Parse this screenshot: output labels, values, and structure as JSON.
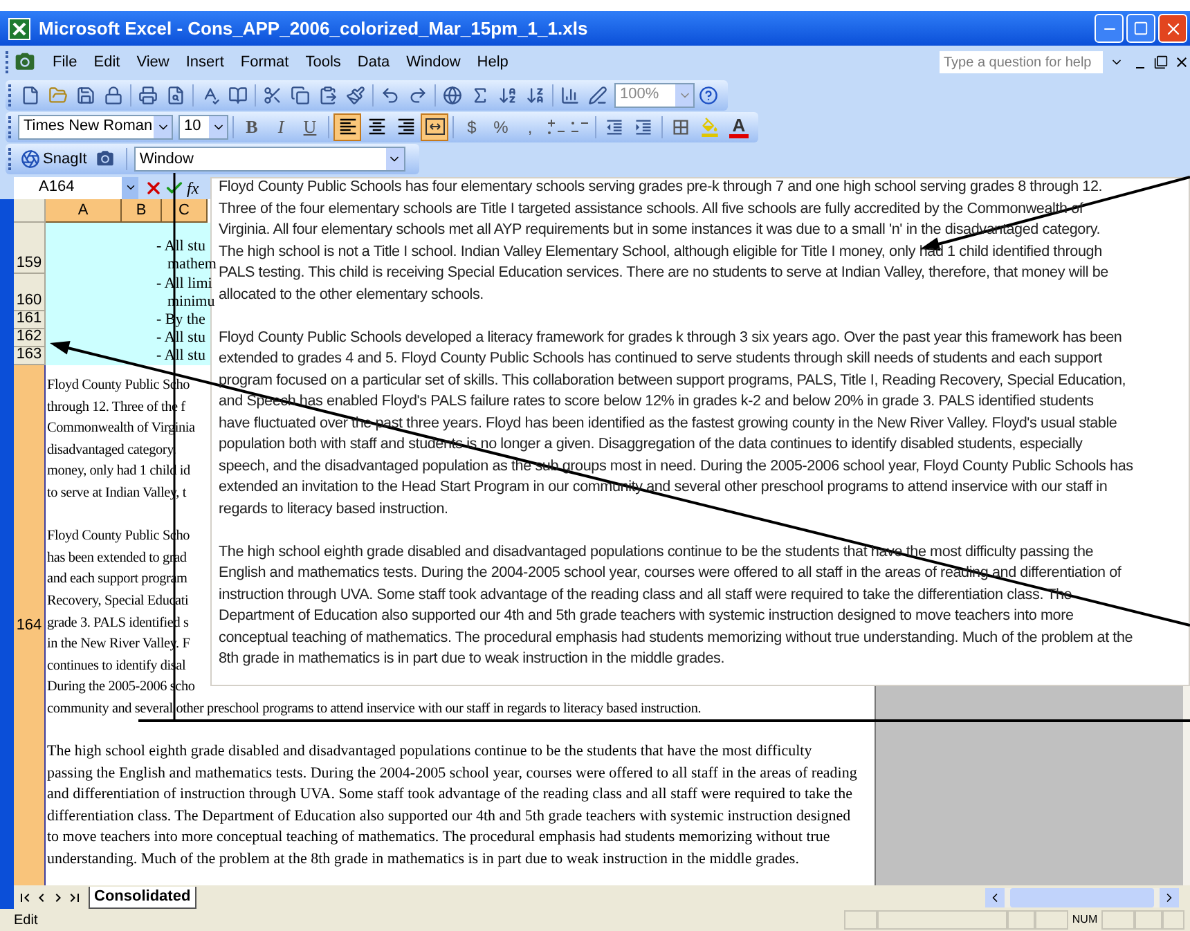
{
  "window": {
    "title": "Microsoft Excel - Cons_APP_2006_colorized_Mar_15pm_1_1.xls"
  },
  "menu": [
    "File",
    "Edit",
    "View",
    "Insert",
    "Format",
    "Tools",
    "Data",
    "Window",
    "Help"
  ],
  "help_box": {
    "placeholder": "Type a question for help"
  },
  "standard_toolbar": {
    "zoom": "100%"
  },
  "formatting_toolbar": {
    "font": "Times New Roman",
    "size": "10",
    "style_buttons": [
      {
        "label": "B",
        "selected": false
      },
      {
        "label": "I",
        "selected": false
      },
      {
        "label": "U",
        "selected": false
      }
    ],
    "align_buttons": [
      {
        "kind": "left",
        "selected": true
      },
      {
        "kind": "center",
        "selected": false
      },
      {
        "kind": "right",
        "selected": false
      },
      {
        "kind": "merge",
        "selected": true
      }
    ],
    "number_buttons": [
      "$",
      "%",
      ","
    ],
    "font_color_label": "A"
  },
  "snagit_toolbar": {
    "label": "SnagIt",
    "dropdown": "Window"
  },
  "formula_bar": {
    "name_box": "A164",
    "function_label": "fx"
  },
  "columns": [
    {
      "label": "A",
      "selected": true
    },
    {
      "label": "B",
      "selected": true
    },
    {
      "label": "C",
      "selected": true
    }
  ],
  "rows": [
    {
      "header": "159",
      "selected": false,
      "lines": [
        "- All stu",
        "mathem"
      ]
    },
    {
      "header": "160",
      "selected": false,
      "lines": [
        "- All limi",
        "minimu"
      ]
    },
    {
      "header": "161",
      "selected": false,
      "lines": [
        "- By the"
      ]
    },
    {
      "header": "162",
      "selected": false,
      "lines": [
        "- All stu"
      ]
    },
    {
      "header": "163",
      "selected": false,
      "lines": [
        "- All stu"
      ]
    }
  ],
  "row_164": {
    "header": "164",
    "selected": true,
    "paragraphs": [
      [
        "Floyd County Public Scho",
        "through 12.  Three of the f",
        "Commonwealth of Virginia",
        "disadvantaged category.",
        "money, only had 1 child id",
        "to serve at Indian Valley, t"
      ],
      [
        "Floyd County Public Scho",
        "has been extended to grad",
        "and each support program",
        "Recovery, Special Educati",
        "grade 3.  PALS identified s",
        "in the New River Valley. F",
        "continues to identify disal",
        "During the 2005-2006 scho",
        "community and several other preschool programs to attend inservice with our staff in regards to literacy based instruction."
      ],
      [
        "The high school eighth grade disabled and disadvantaged populations continue to be the students that have the most difficulty",
        "passing the English and mathematics tests. During the 2004-2005 school year, courses were offered to all  staff in the areas of reading",
        "and  differentiation of instruction through UVA. Some staff took advantage of the reading class and all staff were required to take the",
        "differentiation class. The Department of Education also supported our 4th and 5th grade teachers with systemic instruction designed",
        "to move teachers into more conceptual teaching of mathematics. The procedural emphasis had students memorizing without true",
        "understanding. Much of the problem at the 8th grade in mathematics is in part due to weak instruction in the middle grades."
      ]
    ]
  },
  "edit_popup": {
    "paragraphs": [
      [
        "Floyd County Public Schools has four elementary schools serving grades pre-k through 7 and one high school serving grades 8 through 12.",
        "Three of the four elementary schools are Title I  targeted assistance schools. All five schools are fully accredited by the Commonwealth of",
        "Virginia. All four elementary schools met all AYP requirements but in some instances it was due to a small 'n' in the disadvantaged category.",
        "The high school is not a Title I school.  Indian Valley Elementary School, although eligible for Title I money, only had 1 child identified through",
        "PALS testing.  This child is receiving Special Education services.  There are no students to serve at Indian Valley, therefore, that money will be",
        "allocated to the other elementary schools."
      ],
      [
        "Floyd County Public Schools developed a literacy framework for grades k through 3 six years ago. Over the past year this framework has been",
        "extended to grades 4 and 5. Floyd County Public Schools has continued to serve students through skill needs of students and each support",
        "program focused on a particular set of skills. This collaboration between support programs, PALS, Title I, Reading Recovery, Special Education,",
        "and  Speech has enabled Floyd's PALS failure rates to score below 12% in grades k-2 and below 20% in grade 3.  PALS identified students",
        "have fluctuated over the past three years. Floyd has been identified as the fastest growing county in the New River Valley. Floyd's usual stable",
        "population both with staff and students is no longer a given. Disaggregation of the data continues to identify disabled students, especially",
        "speech, and the disadvantaged population as the sub groups most in need. During the 2005-2006 school year, Floyd County Public Schools has",
        "extended an invitation to the Head Start Program in our community and several other preschool programs to attend inservice with our staff in",
        "regards to literacy based instruction."
      ],
      [
        "The high school eighth grade disabled and disadvantaged populations continue to be the students that have the most difficulty passing the",
        "English and mathematics tests. During the 2004-2005 school year, courses were offered to all  staff in the areas of reading and  differentiation of",
        "instruction through UVA. Some staff took advantage of the reading class and all staff were required to take the differentiation class. The",
        "Department of Education also supported our 4th and 5th grade teachers with systemic instruction designed to move teachers into more",
        "conceptual teaching of mathematics. The procedural emphasis had students memorizing without true understanding. Much of the problem at the",
        "8th grade in mathematics is in part due to weak instruction in the middle grades."
      ]
    ]
  },
  "sheet_tabs": [
    {
      "label": "Consolidated",
      "selected": true
    }
  ],
  "status_bar": {
    "mode": "Edit",
    "num": "NUM"
  }
}
